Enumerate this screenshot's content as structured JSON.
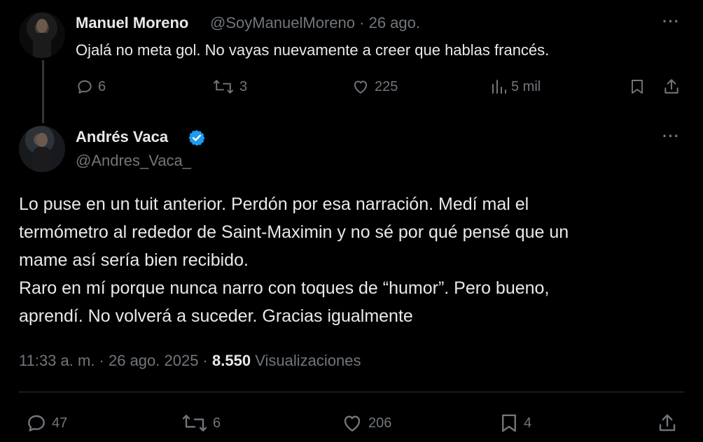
{
  "reply_tweet": {
    "author_name": "Manuel Moreno",
    "author_handle": "@SoyManuelMoreno",
    "date": "26 ago.",
    "text": "Ojalá no meta gol. No vayas nuevamente a creer que hablas francés.",
    "reply_count": "6",
    "retweet_count": "3",
    "like_count": "225",
    "view_count": "5 mil"
  },
  "main_tweet": {
    "author_name": "Andrés Vaca",
    "author_handle": "@Andres_Vaca_",
    "text": "Lo puse en un tuit anterior. Perdón por esa narración. Medí mal el\ntermómetro al rededor de Saint-Maximin y no sé por qué pensé que un\nmame así sería bien recibido.\nRaro en mí porque nunca narro con toques de “humor”. Pero bueno,\naprendí. No volverá a suceder. Gracias igualmente",
    "time": "11:33 a. m. · 26 ago. 2025 ·",
    "views": "8.550",
    "views_label": "Visualizaciones",
    "reply_count": "47",
    "retweet_count": "6",
    "like_count": "206",
    "bookmark_count": "4"
  },
  "more_icon": "···",
  "colors": {
    "background": "#000000",
    "text": "#e7e9ea",
    "muted": "#71767b",
    "verified": "#1d9bf0"
  }
}
